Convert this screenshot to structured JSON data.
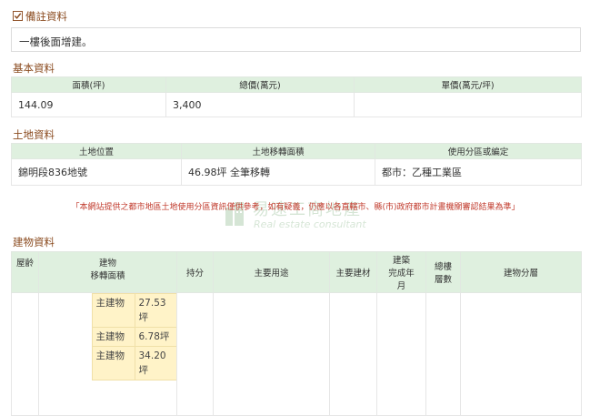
{
  "remarks": {
    "title": "備註資料",
    "text": "一樓後面增建。"
  },
  "basic": {
    "title": "基本資料",
    "headers": [
      "面積(坪)",
      "總價(萬元)",
      "單價(萬元/坪)"
    ],
    "values": [
      "144.09",
      "3,400",
      ""
    ]
  },
  "land": {
    "title": "土地資料",
    "headers": [
      "土地位置",
      "土地移轉面積",
      "使用分區或編定"
    ],
    "values": [
      "錦明段836地號",
      "46.98坪 全筆移轉",
      "都市：乙種工業區"
    ]
  },
  "notice": "「本網站提供之都市地區土地使用分區資訊僅供參考，如有疑義，仍應以各直轄市、縣(市)政府都市計畫機關審認結果為準」",
  "watermark": {
    "title": "易速工商地產",
    "subtitle": "Real estate consultant"
  },
  "building": {
    "title": "建物資料",
    "headers": [
      "屋齡",
      "建物\n移轉面積",
      "持分",
      "主要用途",
      "主要建材",
      "建築\n完成年\n月",
      "總樓\n層數",
      "建物分層"
    ],
    "parts": [
      {
        "label": "主建物",
        "area": "27.53坪"
      },
      {
        "label": "主建物",
        "area": "6.78坪"
      },
      {
        "label": "主建物",
        "area": "34.20坪"
      }
    ]
  }
}
